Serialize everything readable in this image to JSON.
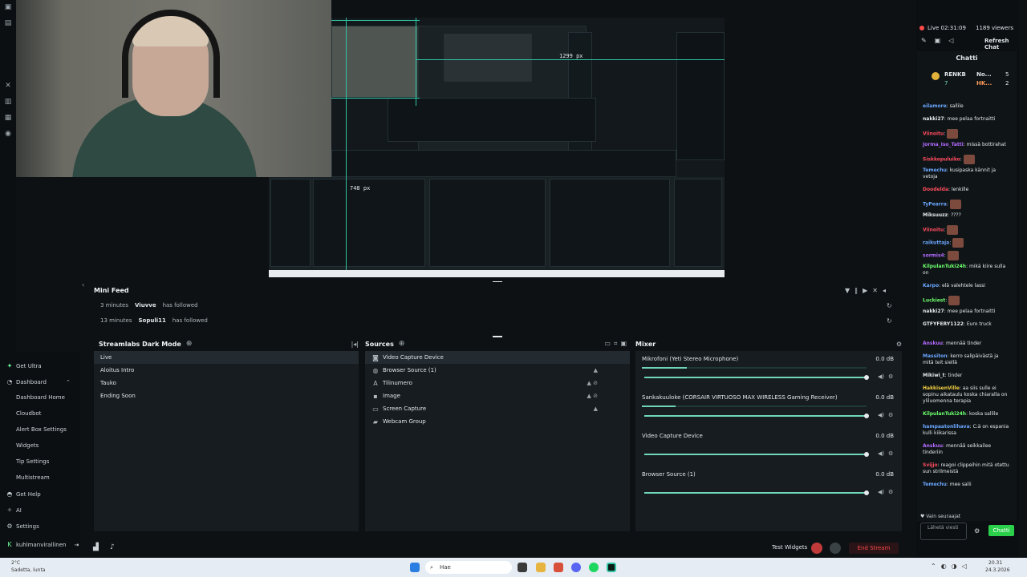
{
  "preview": {
    "dim_width": "1299 px",
    "dim_height": "748 px"
  },
  "sidebar": {
    "items": [
      {
        "label": "Get Ultra",
        "icon": "ultra-icon"
      },
      {
        "label": "Dashboard",
        "icon": "dashboard-icon"
      },
      {
        "label": "Dashboard Home"
      },
      {
        "label": "Cloudbot"
      },
      {
        "label": "Alert Box Settings"
      },
      {
        "label": "Widgets"
      },
      {
        "label": "Tip Settings"
      },
      {
        "label": "Multistream"
      },
      {
        "label": "Get Help",
        "icon": "help-icon"
      },
      {
        "label": "AI",
        "icon": "ai-icon"
      },
      {
        "label": "Settings",
        "icon": "settings-icon"
      }
    ],
    "user": "kuhlmanvirallinen"
  },
  "minifeed": {
    "title": "Mini Feed",
    "events": [
      {
        "time": "3 minutes",
        "user": "Viuvve",
        "action": "has followed"
      },
      {
        "time": "13 minutes",
        "user": "Sopuli11",
        "action": "has followed"
      }
    ]
  },
  "scenes": {
    "title": "Streamlabs Dark Mode",
    "items": [
      "Live",
      "Aloitus Intro",
      "Tauko",
      "Ending Soon"
    ]
  },
  "sources": {
    "title": "Sources",
    "items": [
      {
        "label": "Video Capture Device",
        "icon": "camera-icon"
      },
      {
        "label": "Browser Source (1)",
        "icon": "globe-icon"
      },
      {
        "label": "Tilinumero",
        "icon": "text-icon"
      },
      {
        "label": "Image",
        "icon": "image-icon"
      },
      {
        "label": "Screen Capture",
        "icon": "monitor-icon"
      },
      {
        "label": "Webcam Group",
        "icon": "folder-icon"
      }
    ]
  },
  "mixer": {
    "title": "Mixer",
    "channels": [
      {
        "name": "Mikrofoni (Yeti Stereo Microphone)",
        "db": "0.0 dB",
        "level": 0.2
      },
      {
        "name": "Sankakuuloke (CORSAIR VIRTUOSO MAX WIRELESS Gaming Receiver)",
        "db": "0.0 dB",
        "level": 0.15
      },
      {
        "name": "Video Capture Device",
        "db": "0.0 dB",
        "level": 0
      },
      {
        "name": "Browser Source (1)",
        "db": "0.0 dB",
        "level": 0
      }
    ]
  },
  "bottombar": {
    "test_widgets": "Test Widgets",
    "end_stream": "End Stream"
  },
  "chat": {
    "live": "Live 02:31:09",
    "viewers": "1189 viewers",
    "refresh": "Refresh Chat",
    "title": "Chatti",
    "follow_only": "Vain seuraajat",
    "input_placeholder": "Lähetä viesti",
    "send": "Chatti",
    "leader": {
      "r1": "RENKB",
      "r2": "No...",
      "r3": "HK...",
      "n1": "7",
      "n2": "5",
      "n3": "2"
    },
    "messages": [
      {
        "user": "eilamore",
        "text": "sallile",
        "color": "#6ba7ff"
      },
      {
        "user": "nakki27",
        "text": "mee pelaa fortnaitti",
        "color": "#e6eaec"
      },
      {
        "user": "Viinoitu",
        "text": "",
        "color": "#ff4d5e"
      },
      {
        "user": "Jorma_Iso_Tatti",
        "text": "missä bottirahat",
        "color": "#b36bff"
      },
      {
        "user": "Siskkopuluiko",
        "text": "",
        "color": "#ff4d5e"
      },
      {
        "user": "Temechu",
        "text": "kusipaska kännit ja vetoja",
        "color": "#6ba7ff"
      },
      {
        "user": "Doodelda",
        "text": "lenkille",
        "color": "#ff4d5e"
      },
      {
        "user": "TyPearra",
        "text": "",
        "color": "#6ba7ff"
      },
      {
        "user": "Miksuuzz",
        "text": "????",
        "color": "#e6eaec"
      },
      {
        "user": "Viinoitu",
        "text": "",
        "color": "#ff4d5e"
      },
      {
        "user": "raikuttaja",
        "text": "",
        "color": "#6ba7ff"
      },
      {
        "user": "sormis4",
        "text": "",
        "color": "#b36bff"
      },
      {
        "user": "KilpulanTuki24h",
        "text": "mikä kiire sulla on",
        "color": "#6dff6d"
      },
      {
        "user": "Karpo",
        "text": "elä valehtele lassi",
        "color": "#6ba7ff"
      },
      {
        "user": "Luckiest",
        "text": "",
        "color": "#6dff6d"
      },
      {
        "user": "nakki27",
        "text": "mee pelaa fortnaitti",
        "color": "#e6eaec"
      },
      {
        "user": "GTFYFERY1122",
        "text": "Euro truck",
        "color": "#e6eaec"
      },
      {
        "user": "Anskuu",
        "text": "mennää tinder",
        "color": "#b36bff"
      },
      {
        "user": "Massiton",
        "text": "kerro salipäivästä ja mitä teit siellä",
        "color": "#6ba7ff"
      },
      {
        "user": "Mikiwi_t",
        "text": "tinder",
        "color": "#e6eaec"
      },
      {
        "user": "HakkisenVille",
        "text": "aa siis sulle ei sopinu aikataulu koska chiaralla on yliluomenna terapia",
        "color": "#f5d142"
      },
      {
        "user": "KilpulanTuki24h",
        "text": "koska sallile",
        "color": "#6dff6d"
      },
      {
        "user": "hampaatonlihava",
        "text": "C:ä on espania kulli kiikarissa",
        "color": "#6ba7ff"
      },
      {
        "user": "Anskuu",
        "text": "mennää seikkailee tinderiin",
        "color": "#b36bff"
      },
      {
        "user": "Svijjo",
        "text": "reagoi clippeihin mitä otettu sun strilmeistä",
        "color": "#ff4d5e"
      },
      {
        "user": "Temechu",
        "text": "mee salii",
        "color": "#6ba7ff"
      }
    ]
  },
  "taskbar": {
    "weather_temp": "2°C",
    "weather_desc": "Sadetta, lunta",
    "search": "Hae",
    "time": "20.31",
    "date": "24.3.2026"
  },
  "colors": {
    "accent": "#31c3a2",
    "end_stream": "#ff4a4a",
    "chat_send": "#2ad04a"
  }
}
